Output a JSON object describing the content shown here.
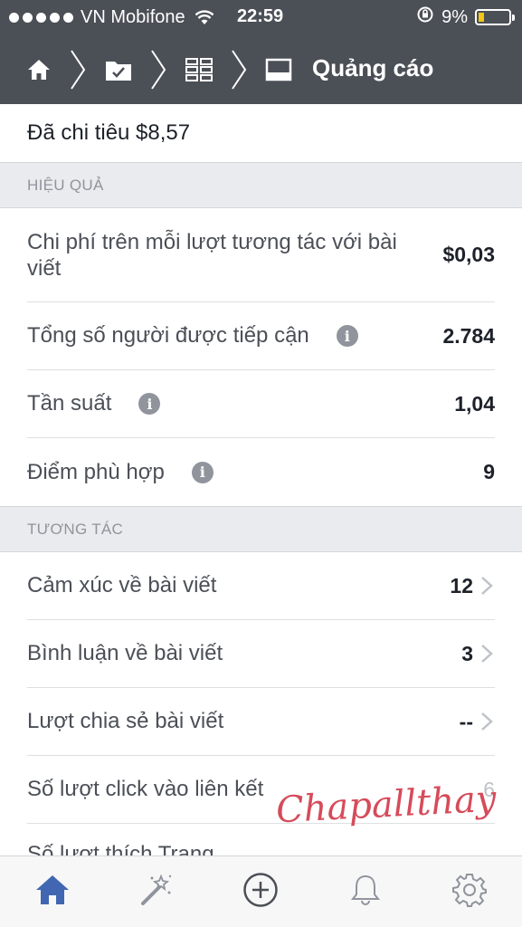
{
  "status_bar": {
    "carrier": "VN Mobifone",
    "time": "22:59",
    "battery": "9%",
    "battery_level": 0.09,
    "icons": [
      "signal-dots",
      "wifi-icon",
      "rotation-lock-icon",
      "battery-icon"
    ]
  },
  "nav": {
    "title": "Quảng cáo",
    "breadcrumb_icons": [
      "home-icon",
      "campaign-folder-icon",
      "grid-icon",
      "ad-preview-icon"
    ]
  },
  "summary": {
    "spent": "Đã chi tiêu $8,57"
  },
  "performance": {
    "header": "HIỆU QUẢ",
    "rows": [
      {
        "label": "Chi phí trên mỗi lượt tương tác với bài viết",
        "value": "$0,03"
      },
      {
        "label": "Tổng số người được tiếp cận",
        "value": "2.784"
      },
      {
        "label": "Tần suất",
        "value": "1,04"
      },
      {
        "label": "Điểm phù hợp",
        "value": "9"
      }
    ]
  },
  "engagement": {
    "header": "TƯƠNG TÁC",
    "rows": [
      {
        "label": "Cảm xúc về bài viết",
        "value": "12"
      },
      {
        "label": "Bình luận về bài viết",
        "value": "3"
      },
      {
        "label": "Lượt chia sẻ bài viết",
        "value": "--"
      },
      {
        "label": "Số lượt click vào liên kết",
        "value": "6"
      },
      {
        "label": "Số lượt thích Trang",
        "value": ""
      }
    ]
  },
  "watermark": "Chapallthay",
  "tabbar": {
    "tabs": [
      "home-icon",
      "magic-wand-icon",
      "add-icon",
      "bell-icon",
      "gear-icon"
    ],
    "active_color": "#4267b2",
    "inactive_color": "#90949c"
  }
}
